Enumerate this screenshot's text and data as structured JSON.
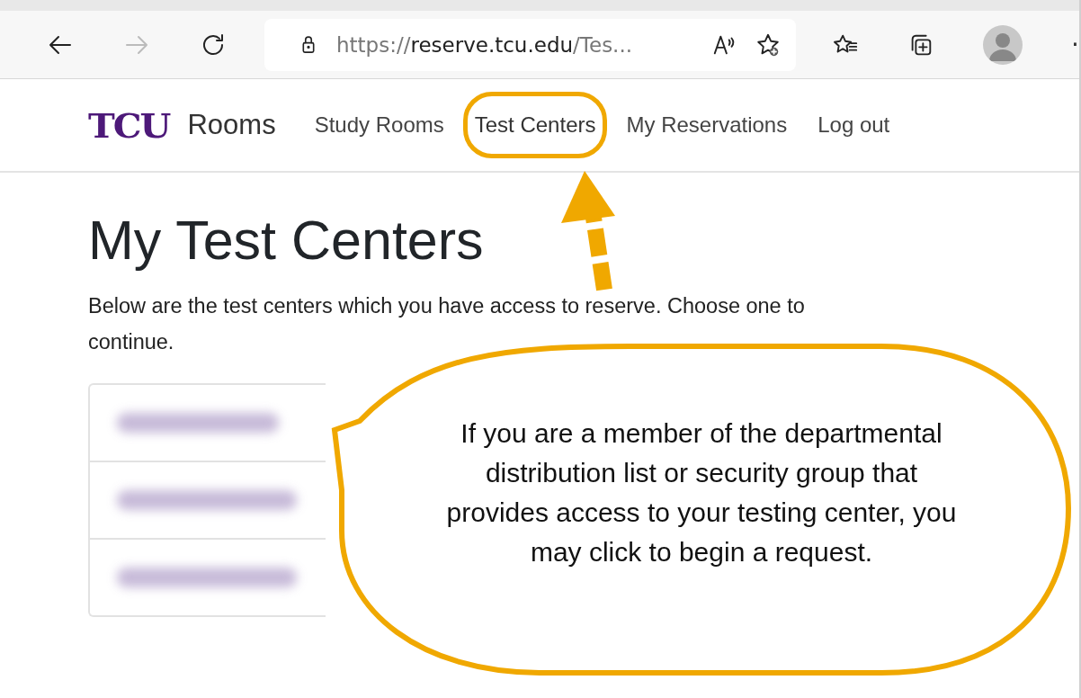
{
  "browser": {
    "url": {
      "scheme": "https://",
      "host": "reserve.tcu.edu",
      "path": "/Tes..."
    },
    "forward_disabled": true,
    "overflow": "·"
  },
  "nav": {
    "logo": "TCU",
    "app_name": "Rooms",
    "links": [
      {
        "label": "Study Rooms",
        "highlighted": false
      },
      {
        "label": "Test Centers",
        "highlighted": true
      },
      {
        "label": "My Reservations",
        "highlighted": false
      },
      {
        "label": "Log out",
        "highlighted": false
      }
    ]
  },
  "page": {
    "title": "My Test Centers",
    "intro": "Below are the test centers which you have access to reserve. Choose one to continue.",
    "test_centers": [
      {
        "kind": "blurred"
      },
      {
        "kind": "blurred"
      },
      {
        "kind": "blurred"
      }
    ]
  },
  "callout": {
    "text": "If you are a member of the departmental distribution list or security group that provides access to your testing center, you may click to begin a request."
  }
}
